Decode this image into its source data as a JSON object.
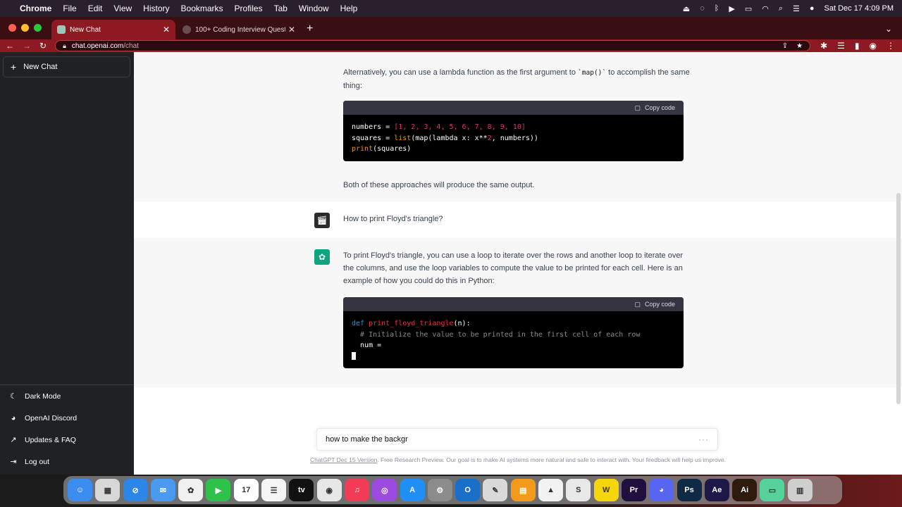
{
  "menubar": {
    "app": "Chrome",
    "items": [
      "File",
      "Edit",
      "View",
      "History",
      "Bookmarks",
      "Profiles",
      "Tab",
      "Window",
      "Help"
    ],
    "datetime": "Sat Dec 17  4:09 PM"
  },
  "tabs": [
    {
      "title": "New Chat",
      "active": true
    },
    {
      "title": "100+ Coding Interview Questio",
      "active": false
    }
  ],
  "address": {
    "domain": "chat.openai.com",
    "path": "/chat"
  },
  "sidebar": {
    "new_chat": "New Chat",
    "bottom_items": [
      {
        "label": "Dark Mode",
        "icon": "moon-icon"
      },
      {
        "label": "OpenAI Discord",
        "icon": "discord-icon"
      },
      {
        "label": "Updates & FAQ",
        "icon": "external-link-icon"
      },
      {
        "label": "Log out",
        "icon": "logout-icon"
      }
    ]
  },
  "conversation": {
    "lambda_intro_1": "Alternatively, you can use a lambda function as the first argument to ",
    "lambda_intro_code": "`map()`",
    "lambda_intro_2": " to accomplish the same thing:",
    "copy_code": "Copy code",
    "code1": {
      "line1_var": "numbers = ",
      "line1_list": "[1, 2, 3, 4, 5, 6, 7, 8, 9, 10]",
      "line2_pre": "squares = ",
      "line2_list": "list",
      "line2_mid": "(map(lambda x: x**",
      "line2_num": "2",
      "line2_post": ", numbers))",
      "line3_fn": "print",
      "line3_post": "(squares)"
    },
    "both_approaches": "Both of these approaches will produce the same output.",
    "user_question": "How to print Floyd's triangle?",
    "answer": "To print Floyd's triangle, you can use a loop to iterate over the rows and another loop to iterate over the columns, and use the loop variables to compute the value to be printed for each cell. Here is an example of how you could do this in Python:",
    "code2": {
      "kw_def": "def ",
      "fn_name": "print_floyd_triangle",
      "params": "(n):",
      "comment": "  # Initialize the value to be printed in the first cell of each row",
      "line3": "  num ="
    }
  },
  "input": {
    "value": "how to make the backgr",
    "dots": "···"
  },
  "footer": {
    "link": "ChatGPT Dec 15 Version",
    "text": ". Free Research Preview. Our goal is to make AI systems more natural and safe to interact with. Your feedback will help us improve."
  },
  "dock": {
    "apps": [
      {
        "name": "Finder",
        "color": "#3b8ef0",
        "glyph": "☺"
      },
      {
        "name": "Launchpad",
        "color": "#d7d7d7",
        "glyph": "▦"
      },
      {
        "name": "Safari",
        "color": "#2b86e8",
        "glyph": "⊘"
      },
      {
        "name": "Mail",
        "color": "#4a9af0",
        "glyph": "✉"
      },
      {
        "name": "Photos",
        "color": "#f0f0f0",
        "glyph": "✿"
      },
      {
        "name": "FaceTime",
        "color": "#2fc24b",
        "glyph": "▶"
      },
      {
        "name": "Calendar",
        "color": "#ffffff",
        "glyph": "17"
      },
      {
        "name": "Reminders",
        "color": "#f5f5f5",
        "glyph": "☰"
      },
      {
        "name": "TV",
        "color": "#111111",
        "glyph": "tv"
      },
      {
        "name": "Chrome",
        "color": "#e6e6e6",
        "glyph": "◉"
      },
      {
        "name": "Music",
        "color": "#f43b55",
        "glyph": "♫"
      },
      {
        "name": "Podcasts",
        "color": "#9b4be0",
        "glyph": "◎"
      },
      {
        "name": "App Store",
        "color": "#1f8ef5",
        "glyph": "A"
      },
      {
        "name": "Settings",
        "color": "#8c8c8c",
        "glyph": "⚙"
      },
      {
        "name": "Outlook",
        "color": "#1a6fc9",
        "glyph": "O"
      },
      {
        "name": "Preview",
        "color": "#d9d9d9",
        "glyph": "✎"
      },
      {
        "name": "Books",
        "color": "#f39a1b",
        "glyph": "▤"
      },
      {
        "name": "VLC",
        "color": "#f2f2f2",
        "glyph": "▲"
      },
      {
        "name": "Sublime",
        "color": "#e8e8e8",
        "glyph": "S"
      },
      {
        "name": "Word",
        "color": "#f5d60a",
        "glyph": "W"
      },
      {
        "name": "Premiere",
        "color": "#1f1040",
        "glyph": "Pr"
      },
      {
        "name": "Discord",
        "color": "#5865f2",
        "glyph": "◕"
      },
      {
        "name": "Photoshop",
        "color": "#0f2a44",
        "glyph": "Ps"
      },
      {
        "name": "After Effects",
        "color": "#1d1846",
        "glyph": "Ae"
      },
      {
        "name": "Illustrator",
        "color": "#2e1a0a",
        "glyph": "Ai"
      },
      {
        "name": "Terminal",
        "color": "#57d19a",
        "glyph": "▭"
      },
      {
        "name": "Trash",
        "color": "#cfcfcf",
        "glyph": "▥"
      }
    ]
  }
}
